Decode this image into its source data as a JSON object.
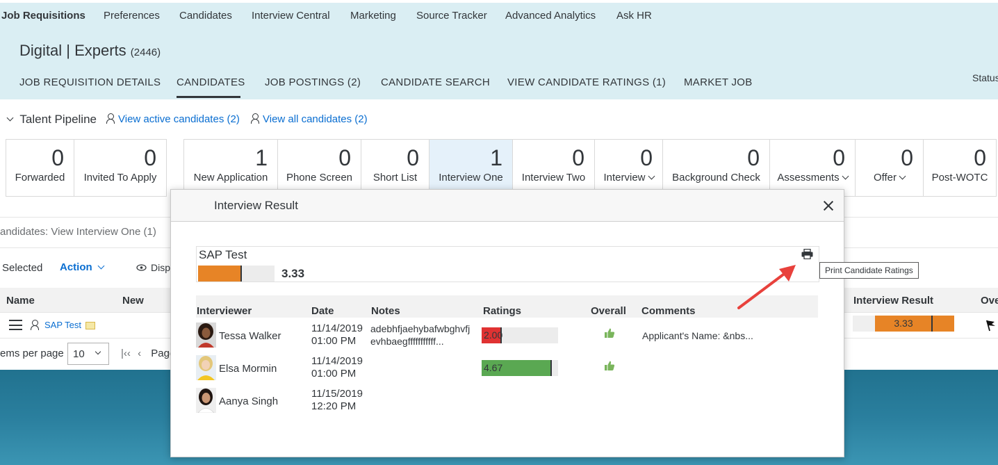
{
  "topnav": [
    "Job Requisitions",
    "Preferences",
    "Candidates",
    "Interview Central",
    "Marketing",
    "Source Tracker",
    "Advanced Analytics",
    "Ask HR"
  ],
  "requisition": {
    "title": "Digital | Experts",
    "count": "(2446)"
  },
  "tabs": [
    "JOB REQUISITION DETAILS",
    "CANDIDATES",
    "JOB POSTINGS (2)",
    "CANDIDATE SEARCH",
    "VIEW CANDIDATE RATINGS (1)",
    "MARKET JOB"
  ],
  "status_cut": "Status",
  "pipeline": {
    "title": "Talent Pipeline",
    "view_active": "View active candidates (2)",
    "view_all": "View all candidates (2)",
    "stages": [
      {
        "count": "0",
        "label": "Forwarded"
      },
      {
        "count": "0",
        "label": "Invited To Apply"
      },
      {
        "count": "1",
        "label": "New Application"
      },
      {
        "count": "0",
        "label": "Phone Screen"
      },
      {
        "count": "0",
        "label": "Short List"
      },
      {
        "count": "1",
        "label": "Interview One"
      },
      {
        "count": "0",
        "label": "Interview Two"
      },
      {
        "count": "0",
        "label": "Interview"
      },
      {
        "count": "0",
        "label": "Background Check"
      },
      {
        "count": "0",
        "label": "Assessments"
      },
      {
        "count": "0",
        "label": "Offer"
      },
      {
        "count": "0",
        "label": "Post-WOTC"
      }
    ]
  },
  "list": {
    "breadcrumb": "andidates: View Interview One (1)",
    "selected": "Selected",
    "action": "Action",
    "display": "Disp",
    "columns": {
      "name": "Name",
      "new": "New",
      "interview_result": "Interview Result",
      "overall": "Ove"
    },
    "row": {
      "name": "SAP Test",
      "interview_result": "3.33"
    },
    "items_per_page_label": "ems per page",
    "items_per_page": "10",
    "page_label": "Page"
  },
  "dialog": {
    "title": "Interview Result",
    "candidate": {
      "name": "SAP Test",
      "score": "3.33",
      "score_fraction": 0.555
    },
    "columns": {
      "interviewer": "Interviewer",
      "date": "Date",
      "notes": "Notes",
      "ratings": "Ratings",
      "overall": "Overall",
      "comments": "Comments"
    },
    "interviews": [
      {
        "name": "Tessa Walker",
        "date": "11/14/2019",
        "time": "01:00 PM",
        "notes1": "adebhfjaehybafwbghvfj",
        "notes2": "evhbaegfffffffffff...",
        "rating": "2.00",
        "rating_fraction": 0.25,
        "rating_color": "#e03232",
        "overall": "thumbs-up-icon",
        "comment": "Applicant's Name:      &nbs..."
      },
      {
        "name": "Elsa Mormin",
        "date": "11/14/2019",
        "time": "01:00 PM",
        "notes1": "",
        "notes2": "",
        "rating": "4.67",
        "rating_fraction": 0.905,
        "rating_color": "#5aa852",
        "overall": "thumbs-up-icon",
        "comment": ""
      },
      {
        "name": "Aanya Singh",
        "date": "11/15/2019",
        "time": "12:20 PM",
        "notes1": "",
        "notes2": "",
        "rating": "",
        "rating_fraction": 0,
        "rating_color": "",
        "overall": "",
        "comment": ""
      }
    ]
  },
  "tooltip": "Print Candidate Ratings",
  "colors": {
    "header_bg": "#daeef3",
    "accent": "#0a6ed1",
    "score_orange": "#e78426"
  }
}
